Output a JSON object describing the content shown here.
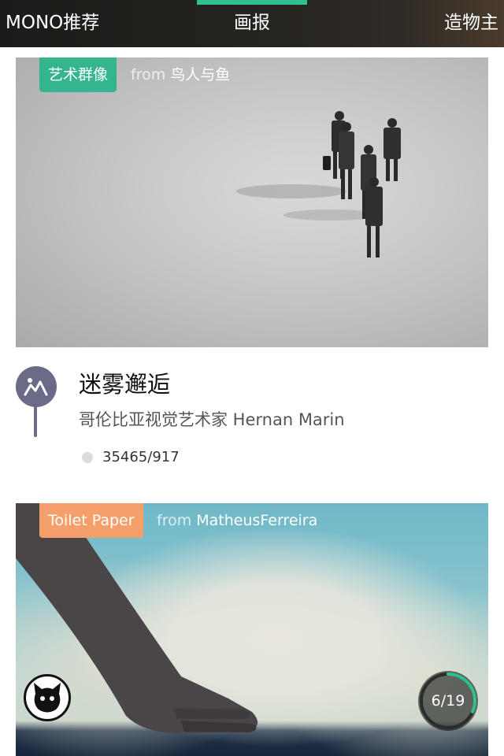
{
  "topnav": {
    "tabs": [
      {
        "label": "MONO推荐"
      },
      {
        "label": "画报"
      },
      {
        "label": "造物主"
      }
    ],
    "active_color": "#2fbf91"
  },
  "cards": [
    {
      "category": "艺术群像",
      "category_color": "#35b58f",
      "from_word": "from",
      "from_name": "鸟人与鱼",
      "title": "迷雾邂逅",
      "subtitle": "哥伦比亚视觉艺术家 Hernan Marin",
      "stats": "35465/917",
      "pin_icon": "mountain-logo-icon"
    },
    {
      "category": "Toilet Paper",
      "category_color": "#f5a06b",
      "from_word": "from",
      "from_name": "MatheusFerreira",
      "progress_text": "6/19",
      "progress": 0.316
    }
  ]
}
